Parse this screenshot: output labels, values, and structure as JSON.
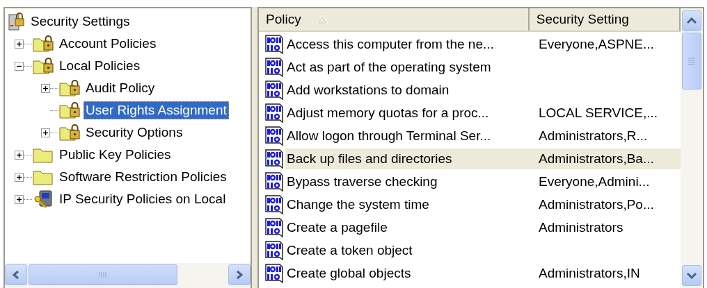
{
  "tree": [
    {
      "label": "Security Settings",
      "kind": "root",
      "selected": false,
      "children": [
        {
          "label": "Account Policies",
          "kind": "lock_folder",
          "expanded": false,
          "selected": false
        },
        {
          "label": "Local Policies",
          "kind": "lock_folder",
          "expanded": true,
          "selected": false,
          "children": [
            {
              "label": "Audit Policy",
              "kind": "lock_folder",
              "expanded": false,
              "selected": false
            },
            {
              "label": "User Rights Assignment",
              "kind": "lock_folder",
              "selected": true
            },
            {
              "label": "Security Options",
              "kind": "lock_folder",
              "expanded": false,
              "selected": false
            }
          ]
        },
        {
          "label": "Public Key Policies",
          "kind": "folder",
          "expanded": false,
          "selected": false
        },
        {
          "label": "Software Restriction Policies",
          "kind": "folder",
          "expanded": false,
          "selected": false
        },
        {
          "label": "IP Security Policies on Local",
          "kind": "ip_security",
          "expanded": false,
          "selected": false
        }
      ]
    }
  ],
  "table": {
    "columns": [
      "Policy",
      "Security Setting"
    ],
    "rows": [
      {
        "policy": "Access this computer from the ne...",
        "setting": "Everyone,ASPNE...",
        "selected": false
      },
      {
        "policy": "Act as part of the operating system",
        "selected": false
      },
      {
        "policy": "Add workstations to domain",
        "selected": false
      },
      {
        "policy": "Adjust memory quotas for a proc...",
        "setting": "LOCAL SERVICE,...",
        "selected": false
      },
      {
        "policy": "Allow logon through Terminal Ser...",
        "setting": "Administrators,R...",
        "selected": false
      },
      {
        "policy": "Back up files and directories",
        "setting": "Administrators,Ba...",
        "selected": true
      },
      {
        "policy": "Bypass traverse checking",
        "setting": "Everyone,Admini...",
        "selected": false
      },
      {
        "policy": "Change the system time",
        "setting": "Administrators,Po...",
        "selected": false
      },
      {
        "policy": "Create a pagefile",
        "setting": "Administrators",
        "selected": false
      },
      {
        "policy": "Create a token object",
        "selected": false
      },
      {
        "policy": "Create global objects",
        "setting": "Administrators,IN",
        "selected": false
      }
    ]
  }
}
